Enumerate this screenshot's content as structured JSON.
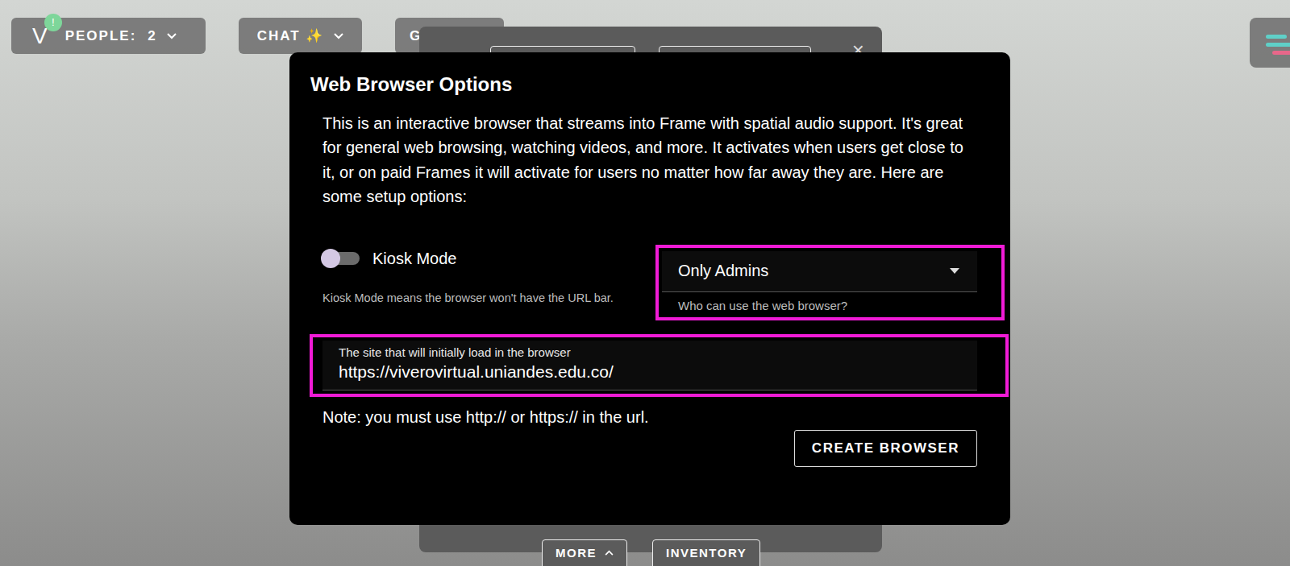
{
  "top_bar": {
    "logo": "V",
    "badge": "!",
    "people": {
      "label": "PEOPLE:",
      "count": "2"
    },
    "chat": {
      "label": "CHAT ✨"
    },
    "third_button": {
      "label": "G"
    }
  },
  "back_panel": {
    "close": "×",
    "buttons": [
      {
        "label": "MORE",
        "chevron": "up"
      },
      {
        "label": "INVENTORY",
        "chevron": "none"
      }
    ]
  },
  "dialog": {
    "title": "Web Browser Options",
    "description": "This is an interactive browser that streams into Frame with spatial audio support. It's great for general web browsing, watching videos, and more. It activates when users get close to it, or on paid Frames it will activate for users no matter how far away they are. Here are some setup options:",
    "kiosk": {
      "label": "Kiosk Mode",
      "on": false,
      "hint": "Kiosk Mode means the browser won't have the URL bar."
    },
    "access": {
      "value": "Only Admins",
      "helper": "Who can use the web browser?",
      "highlighted": true
    },
    "url_field": {
      "label": "The site that will initially load in the browser",
      "value": "https://viverovirtual.uniandes.edu.co/",
      "highlighted": true
    },
    "note": "Note: you must use http:// or https:// in the url.",
    "submit": "CREATE BROWSER"
  }
}
